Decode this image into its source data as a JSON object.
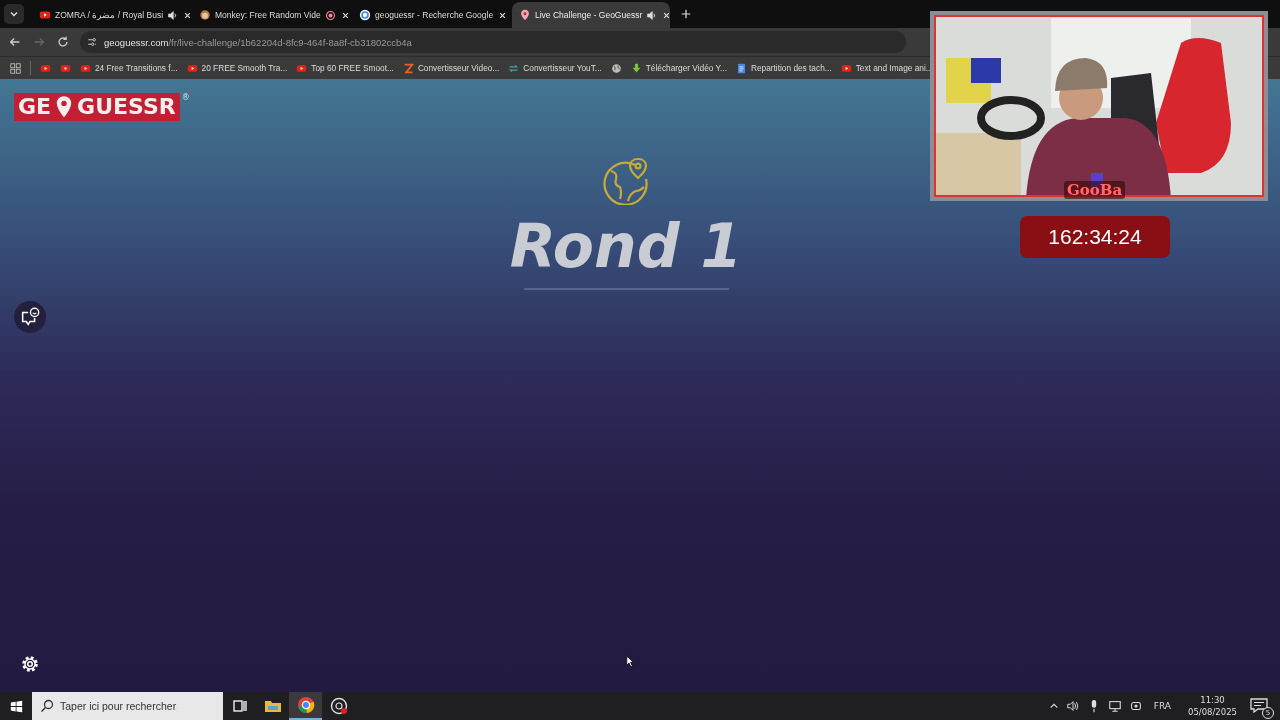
{
  "tabs": [
    {
      "kind": "youtube",
      "title": "ZOMRA / مضرة / Royal Busi",
      "audio": true,
      "recording": false,
      "selected": false
    },
    {
      "kind": "monkey",
      "title": "Monkey: Free Random Vide",
      "audio": false,
      "recording": true,
      "selected": false
    },
    {
      "kind": "google",
      "title": "geoguessr - Recherche Google",
      "audio": false,
      "recording": false,
      "selected": false
    },
    {
      "kind": "pin",
      "title": "Live Challenge - GeoGuessr",
      "audio": true,
      "recording": false,
      "selected": true
    }
  ],
  "address": {
    "domain": "geoguessr.com",
    "path": "/fr/live-challenge/1b62204d-8fc9-464f-8a8f-cb31802ccb4a"
  },
  "bookmarks": [
    {
      "kind": "youtube"
    },
    {
      "kind": "youtube"
    },
    {
      "kind": "youtube",
      "label": "24 Free Transitions f..."
    },
    {
      "kind": "youtube",
      "label": "20 FREE Smooth Tra..."
    },
    {
      "kind": "youtube",
      "label": "Top 60 FREE Smoot..."
    },
    {
      "kind": "z",
      "label": "Convertisseur Video..."
    },
    {
      "kind": "arrows",
      "label": "Convertisseur YouT..."
    },
    {
      "kind": "globe"
    },
    {
      "kind": "download",
      "label": "Télécharger Vidéo Y..."
    },
    {
      "kind": "doc",
      "label": "Repartition des tach..."
    },
    {
      "kind": "youtube",
      "label": "Text and Image ani..."
    }
  ],
  "logo": {
    "left": "GE",
    "right": "GUESSR",
    "mark": "®"
  },
  "round": {
    "title": "Rond 1"
  },
  "overlay": {
    "name": "GooBa",
    "timer": "162:34:24"
  },
  "taskbar": {
    "search_placeholder": "Taper ici pour rechercher",
    "apps": [
      {
        "kind": "taskview",
        "selected": false
      },
      {
        "kind": "folder",
        "selected": false
      },
      {
        "kind": "chrome",
        "selected": true
      },
      {
        "kind": "obs",
        "selected": false
      }
    ],
    "language": "FRA",
    "time": "11:30",
    "date": "05/08/2025",
    "notifications": "5"
  }
}
